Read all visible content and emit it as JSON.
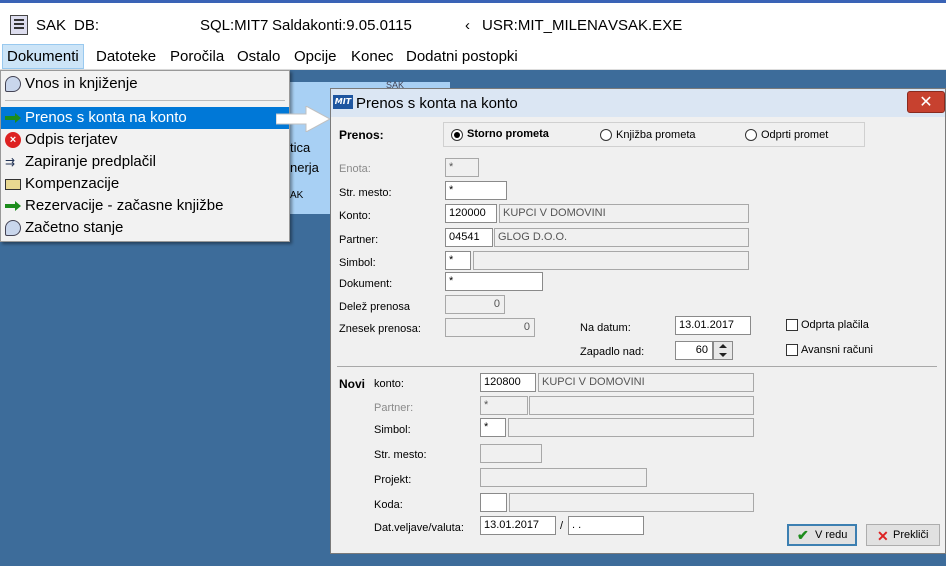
{
  "titlebar": {
    "app": "SAK",
    "db": "DB:",
    "sql": "SQL:MIT7",
    "saldakonti": "Saldakonti:9.05.0115",
    "mark": "‹",
    "usr": "USR:MIT_MILENA",
    "exe": "VSAK.EXE"
  },
  "menubar": [
    "Dokumenti",
    "Datoteke",
    "Poročila",
    "Ostalo",
    "Opcije",
    "Konec",
    "Dodatni postopki"
  ],
  "bgwindow": {
    "line1": "SAK",
    "line2": "tica",
    "line3": "nerja",
    "line4": "AK"
  },
  "dropdown": [
    {
      "label": "Vnos in knjiženje",
      "icon": "speech-bubble-icon"
    },
    {
      "label": "Prenos s konta na konto",
      "icon": "green-arrow-icon"
    },
    {
      "label": "Odpis terjatev",
      "icon": "red-x-icon"
    },
    {
      "label": "Zapiranje predplačil",
      "icon": "payment-icon"
    },
    {
      "label": "Kompenzacije",
      "icon": "folder-open-icon"
    },
    {
      "label": "Rezervacije - začasne knjižbe",
      "icon": "green-arrow-icon"
    },
    {
      "label": "Začetno stanje",
      "icon": "speech-bubble-icon"
    }
  ],
  "dialog": {
    "logo": "MIT",
    "title": "Prenos s konta na konto",
    "close": "✕",
    "prenos_label": "Prenos:",
    "radios": [
      "Storno prometa",
      "Knjižba prometa",
      "Odprti promet"
    ],
    "labels": {
      "enota": "Enota:",
      "str_mesto": "Str. mesto:",
      "konto": "Konto:",
      "partner": "Partner:",
      "simbol": "Simbol:",
      "dokument": "Dokument:",
      "delez": "Delež prenosa",
      "znesek": "Znesek prenosa:",
      "na_datum": "Na datum:",
      "zapadlo": "Zapadlo nad:",
      "odprta": "Odprta plačila",
      "avansni": "Avansni računi"
    },
    "values": {
      "enota": "*",
      "str_mesto": "*",
      "konto": "120000",
      "konto_name": "KUPCI V DOMOVINI",
      "partner": "04541",
      "partner_name": "GLOG D.O.O.",
      "simbol": "*",
      "simbol_name": "",
      "dokument": "*",
      "delez": "0",
      "znesek": "0",
      "na_datum": "13.01.2017",
      "zapadlo": "60"
    },
    "novi": {
      "heading": "Novi",
      "konto_label": "konto:",
      "konto": "120800",
      "konto_name": "KUPCI V DOMOVINI",
      "partner_label": "Partner:",
      "partner": "*",
      "simbol_label": "Simbol:",
      "simbol": "*",
      "str_mesto_label": "Str. mesto:",
      "projekt_label": "Projekt:",
      "koda_label": "Koda:",
      "datvel_label": "Dat.veljave/valuta:",
      "datvel": "13.01.2017",
      "slash": "/",
      "valuta": " .  ."
    },
    "buttons": {
      "ok": "V redu",
      "cancel": "Prekliči"
    }
  }
}
